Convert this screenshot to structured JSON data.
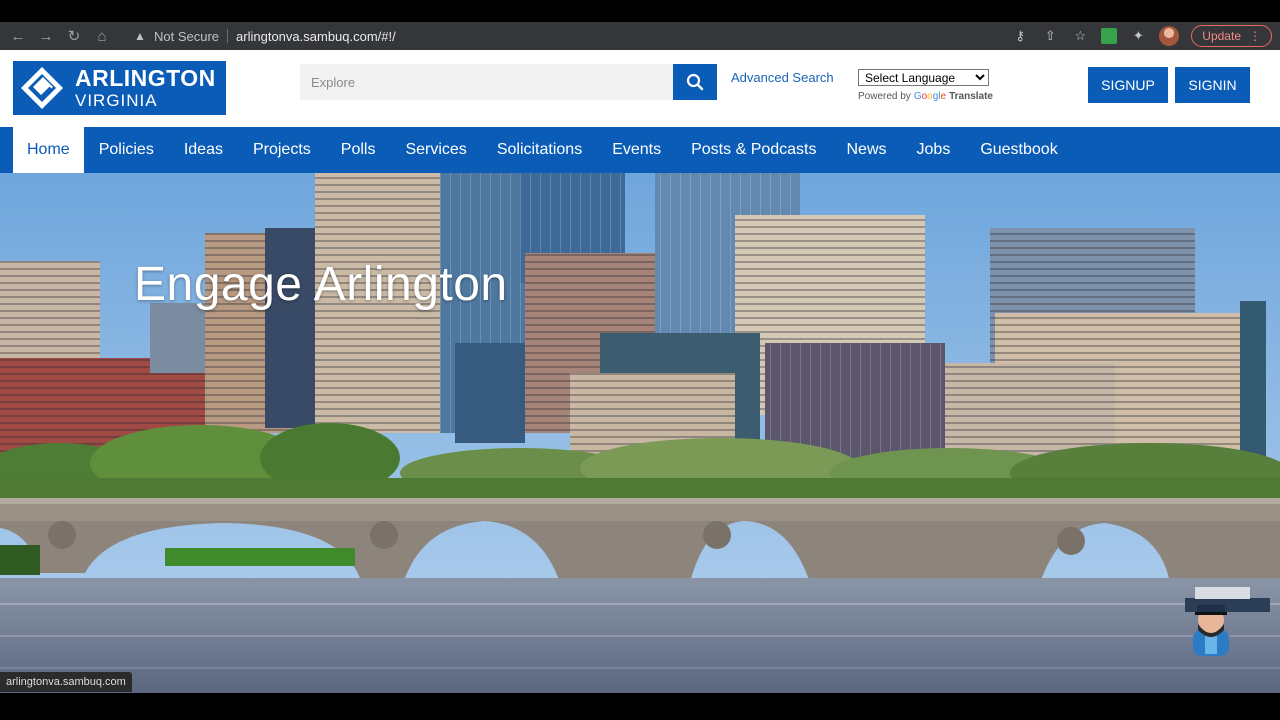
{
  "browser": {
    "not_secure": "Not Secure",
    "url": "arlingtonva.sambuq.com/#!/",
    "update_label": "Update"
  },
  "header": {
    "logo_line1": "ARLINGTON",
    "logo_line2": "VIRGINIA",
    "search_placeholder": "Explore",
    "advanced_search": "Advanced Search",
    "language_select": "Select Language",
    "powered_by": "Powered by",
    "google": "Google",
    "translate": "Translate",
    "signup": "SIGNUP",
    "signin": "SIGNIN"
  },
  "nav": {
    "items": [
      "Home",
      "Policies",
      "Ideas",
      "Projects",
      "Polls",
      "Services",
      "Solicitations",
      "Events",
      "Posts & Podcasts",
      "News",
      "Jobs",
      "Guestbook"
    ],
    "active": "Home"
  },
  "hero": {
    "title": "Engage Arlington"
  },
  "status_bar": {
    "url": "arlingtonva.sambuq.com"
  },
  "colors": {
    "brand_blue": "#0b5cb7",
    "chrome_dark": "#35363a"
  }
}
